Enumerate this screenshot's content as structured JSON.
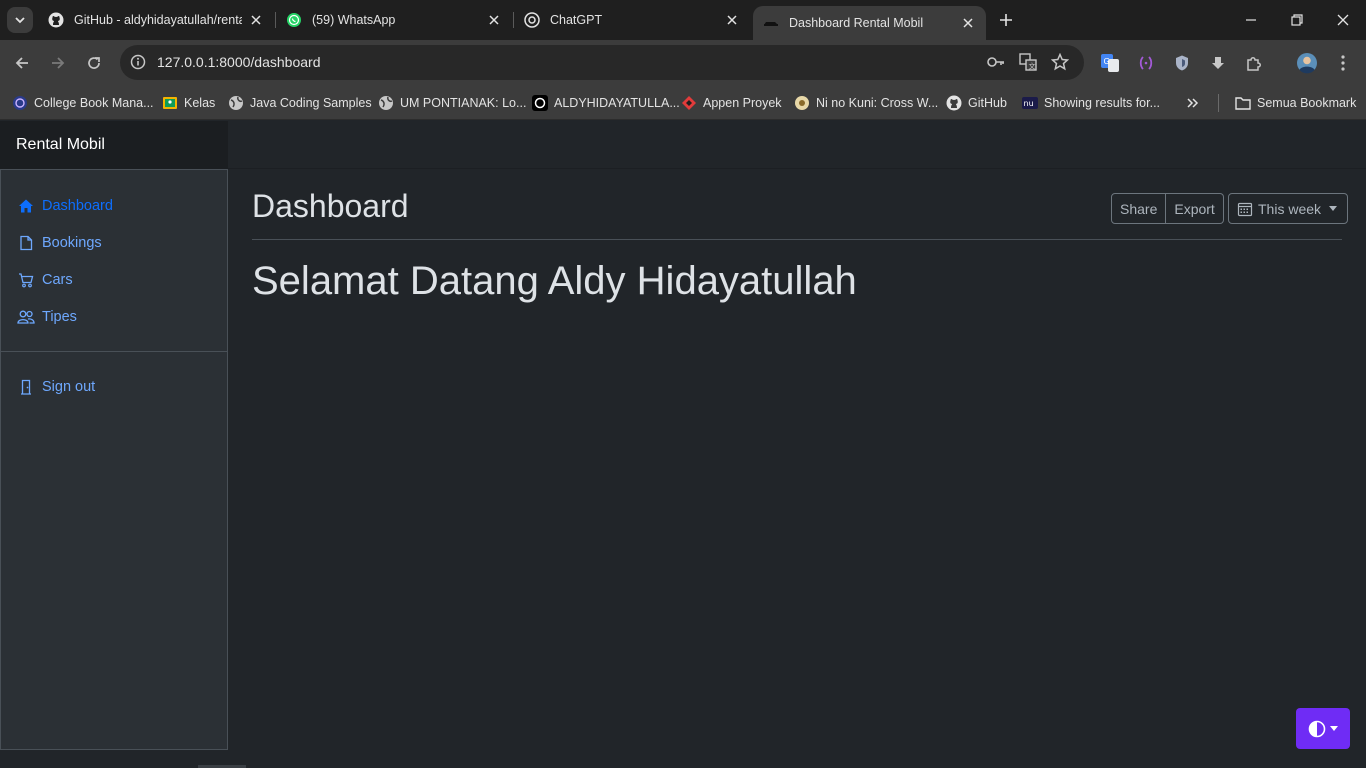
{
  "browser": {
    "tabs": [
      {
        "title": "GitHub - aldyhidayatullah/renta",
        "icon": "github-icon"
      },
      {
        "title": "(59) WhatsApp",
        "icon": "whatsapp-icon"
      },
      {
        "title": "ChatGPT",
        "icon": "chatgpt-icon"
      },
      {
        "title": "Dashboard Rental Mobil",
        "icon": "car-favicon"
      }
    ],
    "url": "127.0.0.1:8000/dashboard",
    "bookmarks": [
      {
        "label": "College Book Mana...",
        "icon": "college-icon"
      },
      {
        "label": "Kelas",
        "icon": "classroom-icon"
      },
      {
        "label": "Java Coding Samples",
        "icon": "globe-icon"
      },
      {
        "label": "UM PONTIANAK: Lo...",
        "icon": "globe-icon"
      },
      {
        "label": "ALDYHIDAYATULLA...",
        "icon": "openai-icon"
      },
      {
        "label": "Appen Proyek",
        "icon": "appen-icon"
      },
      {
        "label": "Ni no Kuni: Cross W...",
        "icon": "ninokuni-icon"
      },
      {
        "label": "GitHub",
        "icon": "github-icon"
      },
      {
        "label": "Showing results for...",
        "icon": "nu-icon"
      }
    ],
    "all_bookmarks_label": "Semua Bookmark"
  },
  "app": {
    "brand": "Rental Mobil",
    "nav": [
      {
        "label": "Dashboard",
        "icon": "house-icon",
        "active": true
      },
      {
        "label": "Bookings",
        "icon": "file-icon",
        "active": false
      },
      {
        "label": "Cars",
        "icon": "cart-icon",
        "active": false
      },
      {
        "label": "Tipes",
        "icon": "people-icon",
        "active": false
      }
    ],
    "signout": {
      "label": "Sign out",
      "icon": "door-icon"
    },
    "page_title": "Dashboard",
    "actions": {
      "share": "Share",
      "export": "Export",
      "period": "This week"
    },
    "welcome": "Selamat Datang Aldy Hidayatullah"
  },
  "colors": {
    "accent": "#0d6efd",
    "link": "#6ea8fe",
    "theme_button": "#6f2cf5",
    "bg": "#212529"
  }
}
